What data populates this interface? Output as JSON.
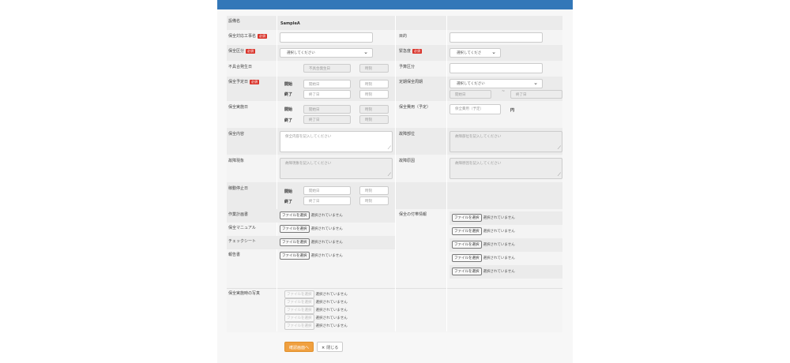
{
  "colors": {
    "header": "#3377b8",
    "required": "#d9342b",
    "confirm": "#f0a040"
  },
  "required_badge": "必須",
  "start": "開始",
  "end": "終了",
  "start_ph": "開始日",
  "end_ph": "終了日",
  "time_ph": "時刻",
  "select_ph": "選択してください",
  "select_ph_short": "選択してくださ",
  "file_button": "ファイルを選択",
  "file_none": "選択されていません",
  "fields": {
    "equipment": {
      "label": "設備名",
      "value": "SampleA"
    },
    "work_name": {
      "label": "保全対応工事名"
    },
    "purpose": {
      "label": "目的"
    },
    "category": {
      "label": "保全区分"
    },
    "urgency": {
      "label": "緊急度"
    },
    "defect_date": {
      "label": "不具合発生日",
      "placeholder": "不具合発生日"
    },
    "budget": {
      "label": "予算区分"
    },
    "planned": {
      "label": "保全予定日"
    },
    "cycle": {
      "label": "定期保全周期",
      "start_ph": "開始日",
      "tilde": "~",
      "end_ph": "終了日"
    },
    "actual": {
      "label": "保全実施日"
    },
    "cost": {
      "label": "保全費用（予定）",
      "placeholder": "保全費用（予定）",
      "unit": "円"
    },
    "content": {
      "label": "保全内容",
      "placeholder": "保全内容を記入してください"
    },
    "fault_part": {
      "label": "故障部位",
      "placeholder": "故障部位を記入してください"
    },
    "phenomenon": {
      "label": "故障現象",
      "placeholder": "故障現象を記入してください"
    },
    "cause": {
      "label": "故障原因",
      "placeholder": "故障原因を記入してください"
    },
    "stop": {
      "label": "稼動停止日"
    },
    "work_plan": {
      "label": "作業計画書"
    },
    "manual": {
      "label": "保全マニュアル"
    },
    "checksheet": {
      "label": "チェックシート"
    },
    "report": {
      "label": "報告書"
    },
    "extra": {
      "label": "保全の付帯情報"
    },
    "photos": {
      "label": "保全実施時の写真"
    }
  },
  "buttons": {
    "confirm": "確認画面へ",
    "close": "閉じる",
    "close_icon": "×"
  }
}
